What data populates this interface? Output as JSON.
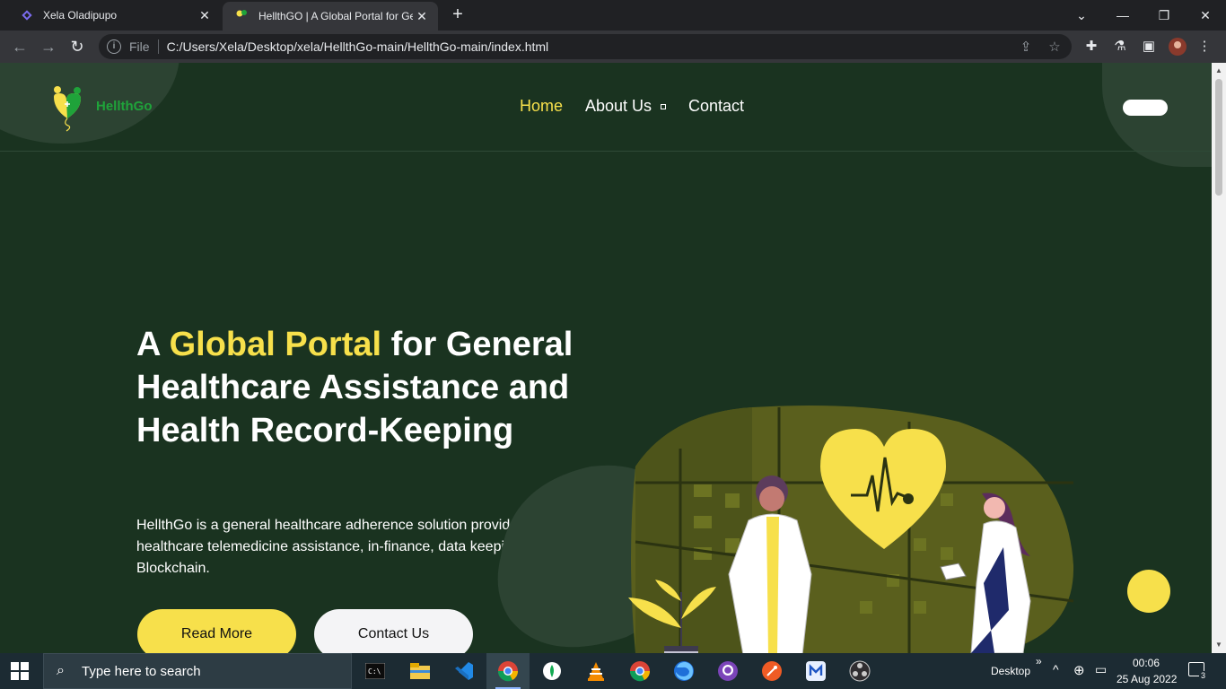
{
  "browser": {
    "tabs": [
      {
        "title": "Xela Oladipupo",
        "active": false
      },
      {
        "title": "HellthGO | A Global Portal for Ge",
        "active": true
      }
    ],
    "new_tab_icon": "plus-icon",
    "url_scheme_label": "File",
    "url": "C:/Users/Xela/Desktop/xela/HellthGo-main/HellthGo-main/index.html"
  },
  "site": {
    "brand": "HellthGo",
    "nav": [
      {
        "label": "Home",
        "active": true
      },
      {
        "label": "About Us",
        "active": false
      },
      {
        "label": "Contact",
        "active": false
      }
    ],
    "hero": {
      "title_part1": "A ",
      "title_highlight": "Global Portal",
      "title_part2": " for General Healthcare Assistance and Health Record-Keeping",
      "description": "HellthGo is a general healthcare adherence solution provider, bridging healthcare telemedicine assistance, in-finance, data keeping via the Blockchain.",
      "primary_button": "Read More",
      "secondary_button": "Contact Us"
    },
    "colors": {
      "background": "#1a3320",
      "accent": "#f7e04b",
      "brand": "#1fa33a"
    }
  },
  "taskbar": {
    "search_placeholder": "Type here to search",
    "desktop_label": "Desktop",
    "time": "00:06",
    "date": "25 Aug 2022",
    "notification_count": "3"
  }
}
